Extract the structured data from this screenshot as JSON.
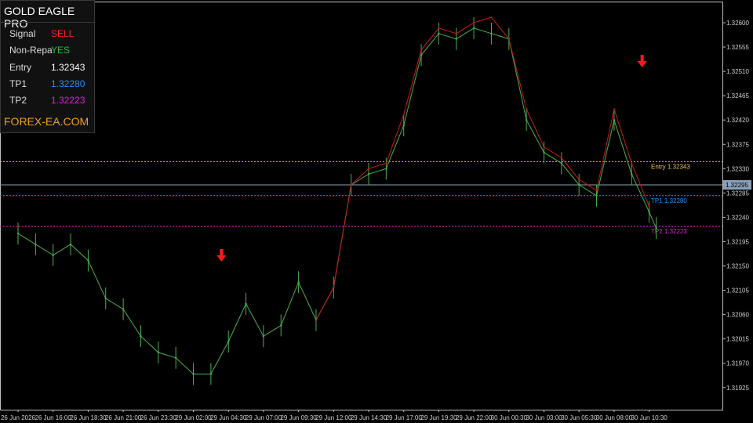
{
  "panel": {
    "title": "GOLD EAGLE PRO",
    "rows": [
      {
        "label": "Signal",
        "value": "SELL",
        "color": "#ff2020"
      },
      {
        "label": "Non-Repa",
        "value": "YES",
        "color": "#20c040"
      },
      {
        "label": "Entry",
        "value": "1.32343",
        "color": "#ffffff"
      },
      {
        "label": "TP1",
        "value": "1.32280",
        "color": "#1e90ff"
      },
      {
        "label": "TP2",
        "value": "1.32223",
        "color": "#e020e0"
      }
    ],
    "brand": "FOREX-EA.COM",
    "brand_color": "#f0a020"
  },
  "chart_data": {
    "type": "line",
    "title": "",
    "xlabel": "",
    "ylabel": "",
    "ylim": [
      1.319,
      1.3262
    ],
    "y_ticks": [
      "1.32600",
      "1.32555",
      "1.32510",
      "1.32465",
      "1.32420",
      "1.32375",
      "1.32330",
      "1.32285",
      "1.32240",
      "1.32195",
      "1.32150",
      "1.32105",
      "1.32060",
      "1.32015",
      "1.31970",
      "1.31925"
    ],
    "x_ticks": [
      "26 Jun 2026",
      "26 Jun 16:00",
      "26 Jun 18:30",
      "26 Jun 21:00",
      "26 Jun 23:30",
      "29 Jun 02:00",
      "29 Jun 04:30",
      "29 Jun 07:00",
      "29 Jun 09:30",
      "29 Jun 12:00",
      "29 Jun 14:30",
      "29 Jun 17:00",
      "29 Jun 19:30",
      "29 Jun 22:00",
      "30 Jun 00:30",
      "30 Jun 03:00",
      "30 Jun 05:30",
      "30 Jun 08:00",
      "30 Jun 10:30"
    ],
    "current_price": "1.32295",
    "price_series": {
      "color": "#4caf50",
      "x": [
        0,
        0.5,
        1,
        1.5,
        2,
        2.5,
        3,
        3.5,
        4,
        4.5,
        5,
        5.5,
        6,
        6.5,
        7,
        7.5,
        8,
        8.5,
        9,
        9.5,
        10,
        10.5,
        11,
        11.5,
        12,
        12.5,
        13,
        13.5,
        14,
        14.5,
        15,
        15.5,
        16,
        16.5,
        17,
        17.5,
        18,
        18.2
      ],
      "y": [
        1.3221,
        1.3219,
        1.3217,
        1.3219,
        1.3216,
        1.3209,
        1.3207,
        1.3202,
        1.3199,
        1.3198,
        1.3195,
        1.3195,
        1.3201,
        1.3208,
        1.3202,
        1.3204,
        1.3212,
        1.3205,
        1.3211,
        1.323,
        1.3232,
        1.3233,
        1.3241,
        1.3254,
        1.3258,
        1.3257,
        1.3259,
        1.3258,
        1.3257,
        1.3242,
        1.3236,
        1.3234,
        1.323,
        1.3228,
        1.3242,
        1.3232,
        1.3225,
        1.3222
      ]
    },
    "indicator_series": {
      "color": "#cc1a1a",
      "x": [
        8.5,
        9,
        9.5,
        10,
        10.5,
        11,
        11.5,
        12,
        12.5,
        13,
        13.5,
        14,
        14.5,
        15,
        15.5,
        16,
        16.5,
        17,
        17.5,
        18
      ],
      "y": [
        1.3205,
        1.3211,
        1.323,
        1.3233,
        1.3234,
        1.3243,
        1.3255,
        1.3259,
        1.3258,
        1.326,
        1.3261,
        1.3257,
        1.3244,
        1.3237,
        1.3235,
        1.3231,
        1.3229,
        1.3244,
        1.3234,
        1.3226
      ]
    },
    "levels": [
      {
        "label": "Entry 1.32343",
        "value": 1.32343,
        "color": "#f0c060"
      },
      {
        "label": "TP1 1.32280",
        "value": 1.3228,
        "color": "#1e90ff"
      },
      {
        "label": "TP2 1.32223",
        "value": 1.32223,
        "color": "#e020e0"
      }
    ],
    "sell_arrows": [
      {
        "x": 5.8,
        "color": "#ff1a1a"
      },
      {
        "x": 17.8,
        "color": "#ff1a1a"
      }
    ]
  }
}
